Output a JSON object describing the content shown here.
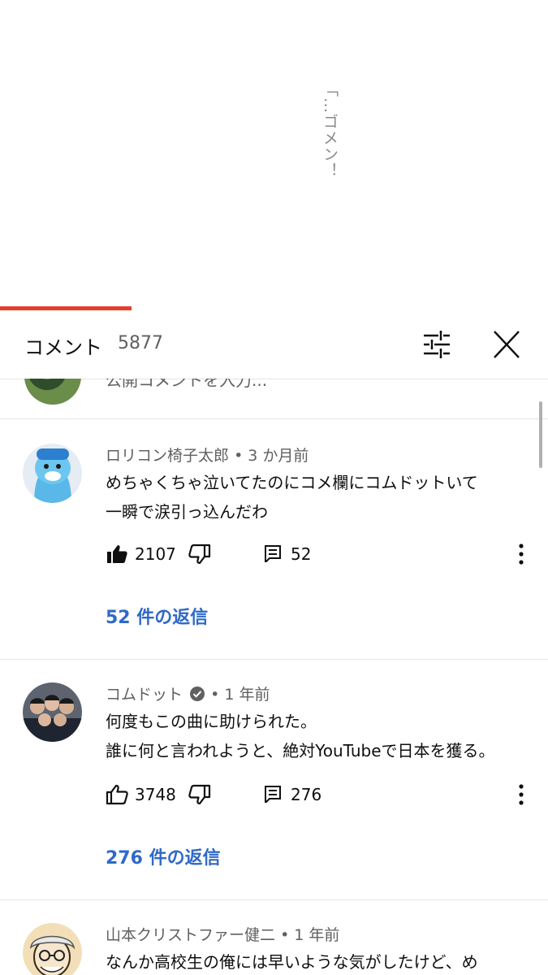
{
  "video": {
    "overlay_text": "「…ゴメン！",
    "progress_fraction": 0.24,
    "accent_color": "#e1412b"
  },
  "header": {
    "title": "コメント",
    "count": "5877",
    "filter_icon": "sort-filter-icon",
    "close_icon": "close-icon"
  },
  "add_comment": {
    "placeholder": "公開コメントを入力..."
  },
  "comments": [
    {
      "author": "ロリコン椅子太郎",
      "verified": false,
      "time": "• 3 か月前",
      "lines": [
        "めちゃくちゃ泣いてたのにコメ欄にコムドットいて",
        "一瞬で涙引っ込んだわ"
      ],
      "likes": "2107",
      "liked": true,
      "reply_count": "52",
      "replies_label": "52 件の返信"
    },
    {
      "author": "コムドット",
      "verified": true,
      "time": "• 1 年前",
      "lines": [
        "何度もこの曲に助けられた。",
        "誰に何と言われようと、絶対YouTubeで日本を獲る。"
      ],
      "likes": "3748",
      "liked": false,
      "reply_count": "276",
      "replies_label": "276 件の返信"
    },
    {
      "author": "山本クリストファー健二",
      "verified": false,
      "time": "• 1 年前",
      "lines": [
        "なんか高校生の俺には早いような気がしたけど、め"
      ]
    }
  ],
  "colors": {
    "link": "#2f6ac7",
    "meta": "#606060",
    "divider": "#e5e5e5"
  }
}
